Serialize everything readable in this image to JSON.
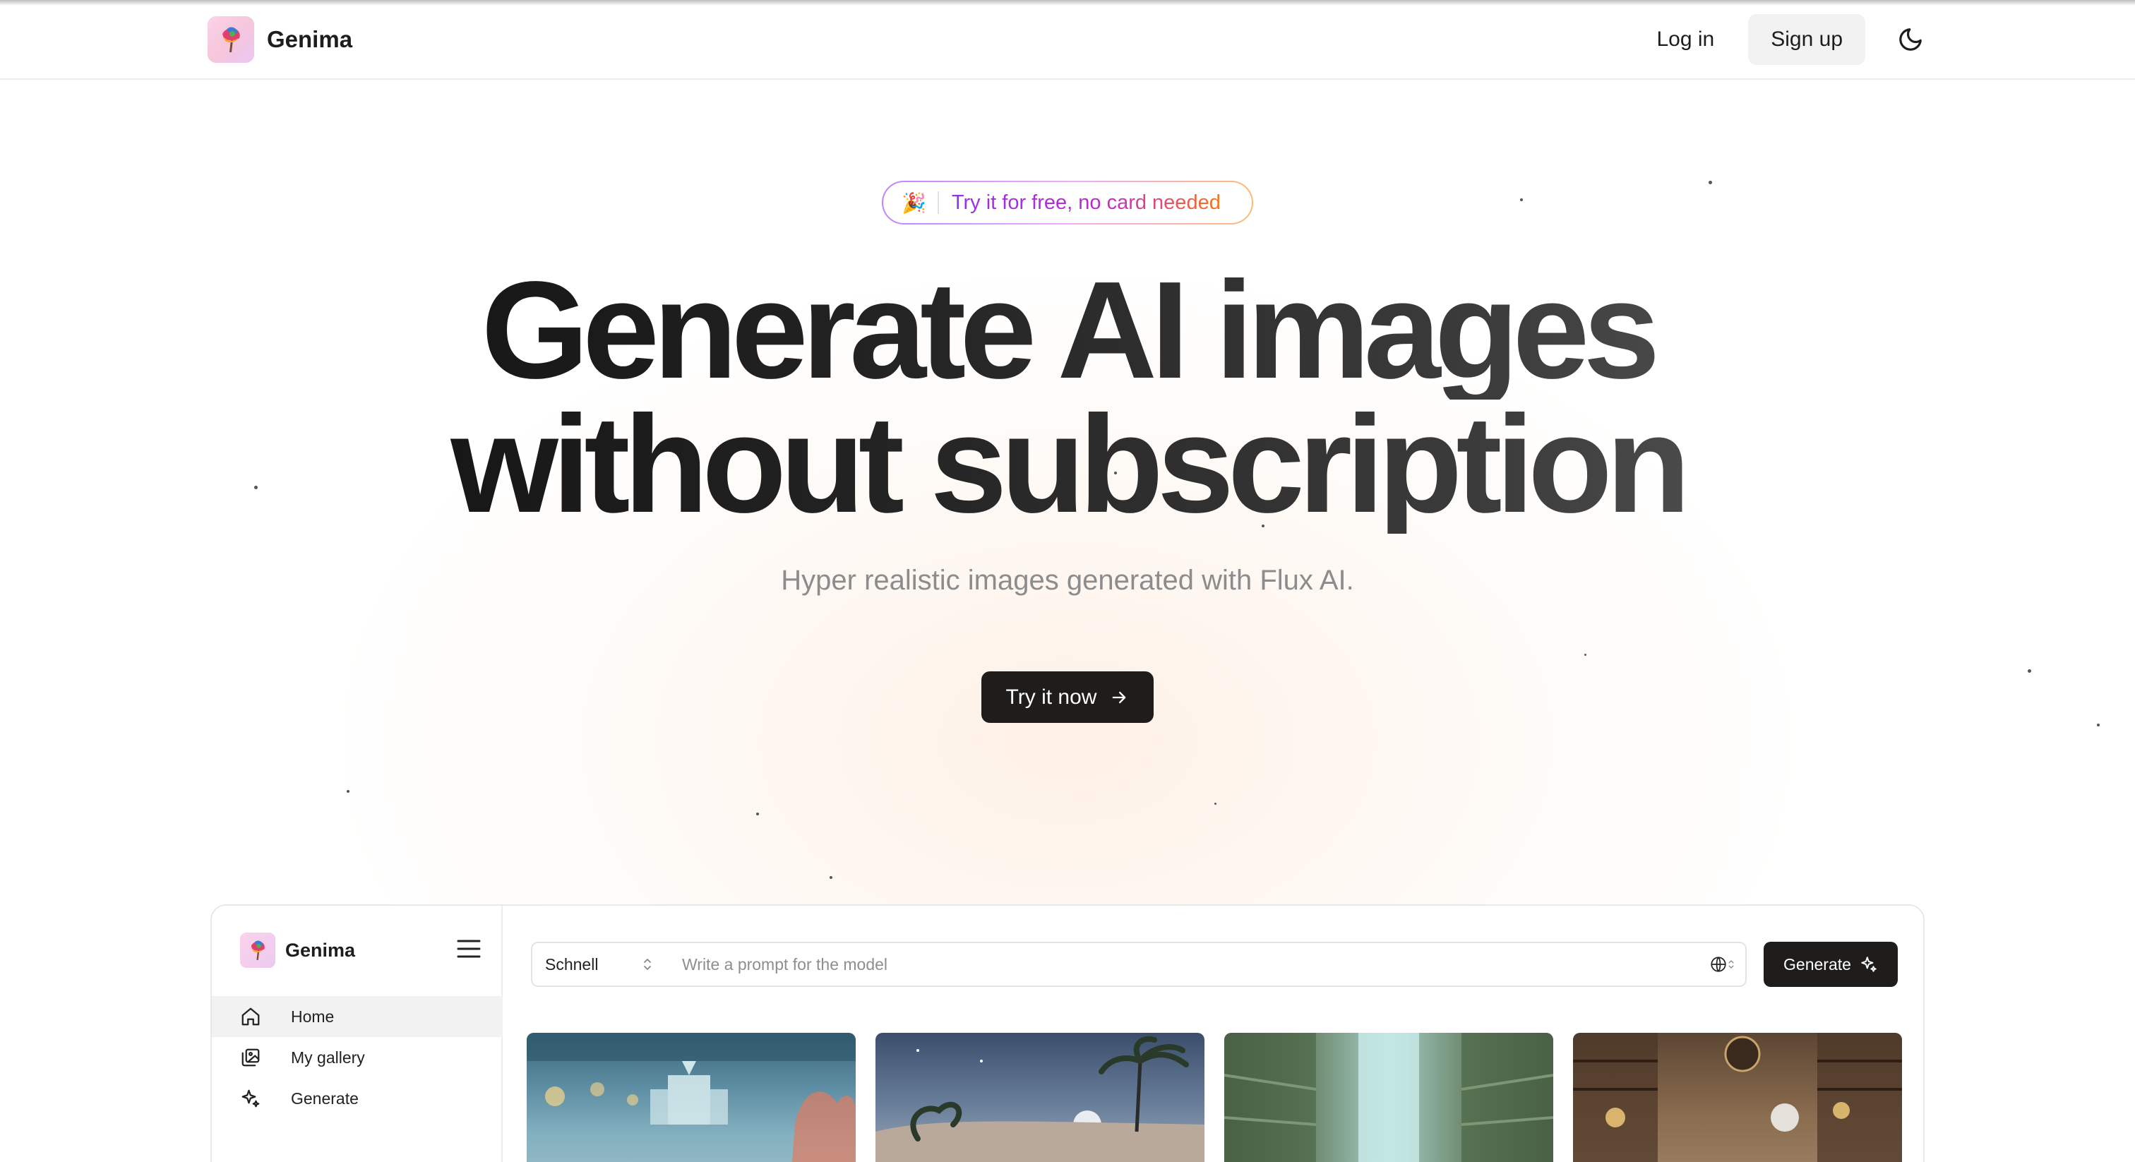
{
  "header": {
    "brand": "Genima",
    "login_label": "Log in",
    "signup_label": "Sign up"
  },
  "hero": {
    "badge_emoji": "🎉",
    "badge_text": "Try it for free, no card needed",
    "title_line1": "Generate AI images",
    "title_line2": "without subscription",
    "subtitle": "Hyper realistic images generated with Flux AI.",
    "cta_label": "Try it now"
  },
  "preview": {
    "brand": "Genima",
    "sidebar": {
      "items": [
        {
          "label": "Home",
          "icon": "home-icon",
          "active": true
        },
        {
          "label": "My gallery",
          "icon": "gallery-icon",
          "active": false
        },
        {
          "label": "Generate",
          "icon": "sparkles-icon",
          "active": false
        }
      ]
    },
    "model_value": "Schnell",
    "prompt_placeholder": "Write a prompt for the model",
    "prompt_value": "",
    "generate_label": "Generate",
    "thumbnails": [
      "underwater-city",
      "desert-palms-moon",
      "forest-canyon",
      "library-scholar"
    ]
  },
  "colors": {
    "primary_button": "#1f1d1c",
    "badge_gradient_start": "#9333ea",
    "badge_gradient_end": "#f97316"
  }
}
